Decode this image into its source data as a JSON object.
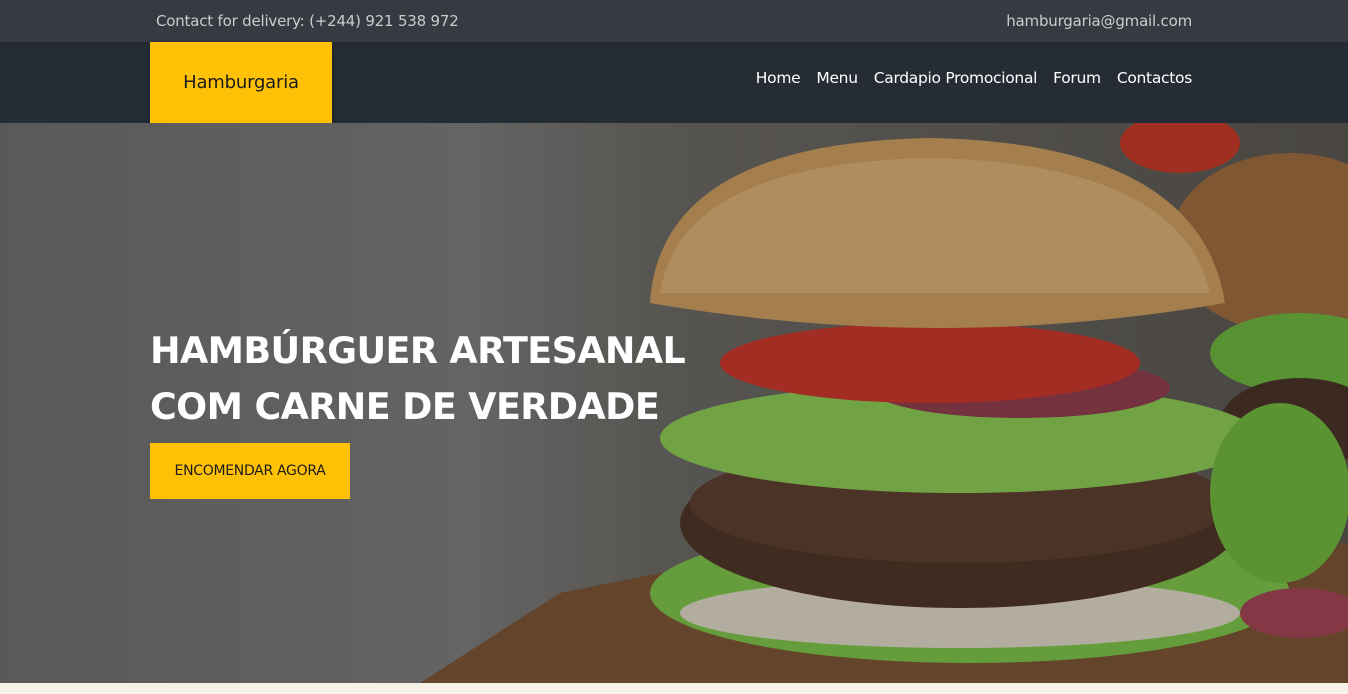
{
  "topbar": {
    "contact": "Contact for delivery: (+244) 921 538 972",
    "email": "hamburgaria@gmail.com"
  },
  "navbar": {
    "logo": "Hamburgaria",
    "links": [
      "Home",
      "Menu",
      "Cardapio Promocional",
      "Forum",
      "Contactos"
    ]
  },
  "hero": {
    "title_line1": "HAMBÚRGUER ARTESANAL",
    "title_line2": "COM CARNE DE VERDADE",
    "cta": "ENCOMENDAR AGORA",
    "image": "burger-photo"
  },
  "colors": {
    "accent": "#ffc106",
    "topbar": "#363b42",
    "navbar": "#262c34"
  }
}
